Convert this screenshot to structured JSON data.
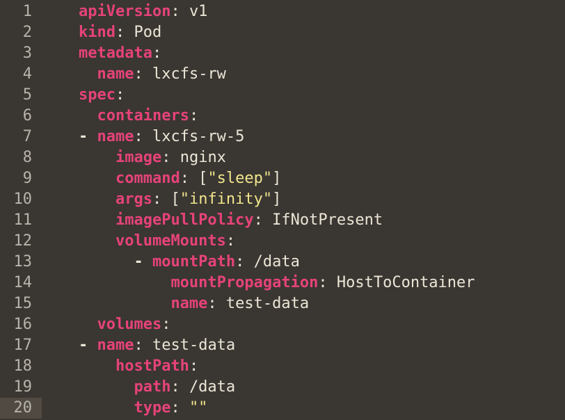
{
  "lines": [
    {
      "num": "1",
      "indent": 0,
      "dash": false,
      "key": "apiVersion",
      "val": "v1",
      "quoted": false
    },
    {
      "num": "2",
      "indent": 0,
      "dash": false,
      "key": "kind",
      "val": "Pod",
      "quoted": false
    },
    {
      "num": "3",
      "indent": 0,
      "dash": false,
      "key": "metadata",
      "val": null,
      "quoted": false
    },
    {
      "num": "4",
      "indent": 1,
      "dash": false,
      "key": "name",
      "val": "lxcfs-rw",
      "quoted": false
    },
    {
      "num": "5",
      "indent": 0,
      "dash": false,
      "key": "spec",
      "val": null,
      "quoted": false
    },
    {
      "num": "6",
      "indent": 1,
      "dash": false,
      "key": "containers",
      "val": null,
      "quoted": false
    },
    {
      "num": "7",
      "indent": 1,
      "dash": true,
      "key": "name",
      "val": "lxcfs-rw-5",
      "quoted": false
    },
    {
      "num": "8",
      "indent": 2,
      "dash": false,
      "key": "image",
      "val": "nginx",
      "quoted": false
    },
    {
      "num": "9",
      "indent": 2,
      "dash": false,
      "key": "command",
      "arr": [
        "sleep"
      ]
    },
    {
      "num": "10",
      "indent": 2,
      "dash": false,
      "key": "args",
      "arr": [
        "infinity"
      ]
    },
    {
      "num": "11",
      "indent": 2,
      "dash": false,
      "key": "imagePullPolicy",
      "val": "IfNotPresent",
      "quoted": false
    },
    {
      "num": "12",
      "indent": 2,
      "dash": false,
      "key": "volumeMounts",
      "val": null,
      "quoted": false
    },
    {
      "num": "13",
      "indent": 4,
      "dash": true,
      "key": "mountPath",
      "val": "/data",
      "quoted": false
    },
    {
      "num": "14",
      "indent": 5,
      "dash": false,
      "key": "mountPropagation",
      "val": "HostToContainer",
      "quoted": false
    },
    {
      "num": "15",
      "indent": 5,
      "dash": false,
      "key": "name",
      "val": "test-data",
      "quoted": false
    },
    {
      "num": "16",
      "indent": 1,
      "dash": false,
      "key": "volumes",
      "val": null,
      "quoted": false
    },
    {
      "num": "17",
      "indent": 1,
      "dash": true,
      "key": "name",
      "val": "test-data",
      "quoted": false
    },
    {
      "num": "18",
      "indent": 2,
      "dash": false,
      "key": "hostPath",
      "val": null,
      "quoted": false
    },
    {
      "num": "19",
      "indent": 3,
      "dash": false,
      "key": "path",
      "val": "/data",
      "quoted": false
    },
    {
      "num": "20",
      "indent": 3,
      "dash": false,
      "key": "type",
      "val": "",
      "quoted": true,
      "active": true
    }
  ],
  "raw_yaml": "apiVersion: v1\nkind: Pod\nmetadata:\n  name: lxcfs-rw\nspec:\n  containers:\n  - name: lxcfs-rw-5\n    image: nginx\n    command: [\"sleep\"]\n    args: [\"infinity\"]\n    imagePullPolicy: IfNotPresent\n    volumeMounts:\n        - mountPath: /data\n          mountPropagation: HostToContainer\n          name: test-data\n  volumes:\n  - name: test-data\n    hostPath:\n      path: /data\n      type: \"\"\n"
}
